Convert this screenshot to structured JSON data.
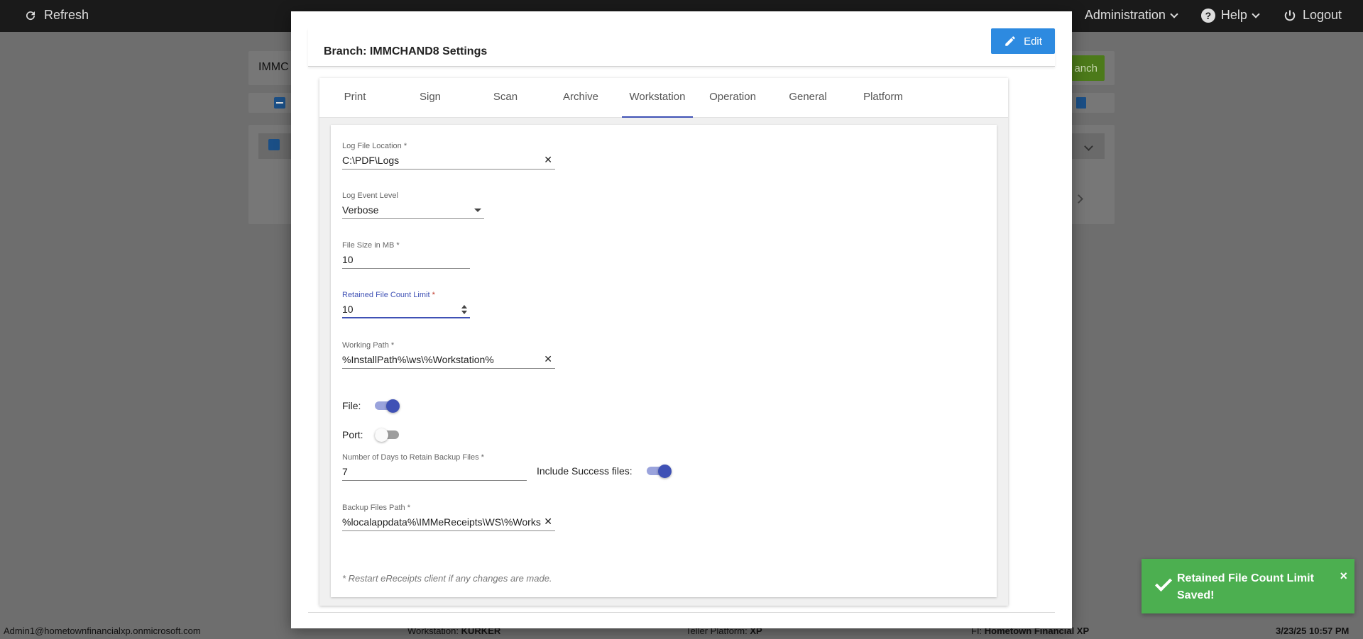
{
  "topbar": {
    "refresh_label": "Refresh",
    "administration_label": "Administration",
    "help_label": "Help",
    "logout_label": "Logout"
  },
  "background": {
    "search_value": "IMMC",
    "action_button": "anch"
  },
  "footer": {
    "user": "Admin1@hometownfinancialxp.onmicrosoft.com",
    "workstation_label": "Workstation:",
    "workstation_value": "KURKER",
    "teller_label": "Teller Platform:",
    "teller_value": "XP",
    "fi_label": "FI:",
    "fi_value": "Hometown Financial XP",
    "datetime": "3/23/25 10:57 PM"
  },
  "dialog": {
    "title": "Branch: IMMCHAND8 Settings",
    "edit_label": "Edit",
    "tabs": [
      "Print",
      "Sign",
      "Scan",
      "Archive",
      "Workstation",
      "Operation",
      "General",
      "Platform"
    ],
    "active_tab": "Workstation",
    "fields": {
      "log_file_location": {
        "label": "Log File Location *",
        "value": "C:\\PDF\\Logs"
      },
      "log_event_level": {
        "label": "Log Event Level",
        "value": "Verbose"
      },
      "file_size_mb": {
        "label": "File Size in MB *",
        "value": "10"
      },
      "retained_file_count": {
        "label": "Retained File Count Limit",
        "required": "*",
        "value": "10"
      },
      "working_path": {
        "label": "Working Path *",
        "value": "%InstallPath%\\ws\\%Workstation%"
      },
      "file_toggle": {
        "label": "File:",
        "on": true
      },
      "port_toggle": {
        "label": "Port:",
        "on": false
      },
      "backup_days": {
        "label": "Number of Days to Retain Backup Files *",
        "value": "7"
      },
      "include_success": {
        "label": "Include Success files:",
        "on": true
      },
      "backup_path": {
        "label": "Backup Files Path *",
        "value": "%localappdata%\\IMMeReceipts\\WS\\%Works"
      }
    },
    "note": "* Restart eReceipts client if any changes are made."
  },
  "snackbar": {
    "message": "Retained File Count Limit Saved!",
    "close": "×"
  },
  "colors": {
    "primary": "#3f51b5",
    "edit_button": "#2d8ae0",
    "success": "#4caf50",
    "topbar": "#1a1a1a"
  }
}
